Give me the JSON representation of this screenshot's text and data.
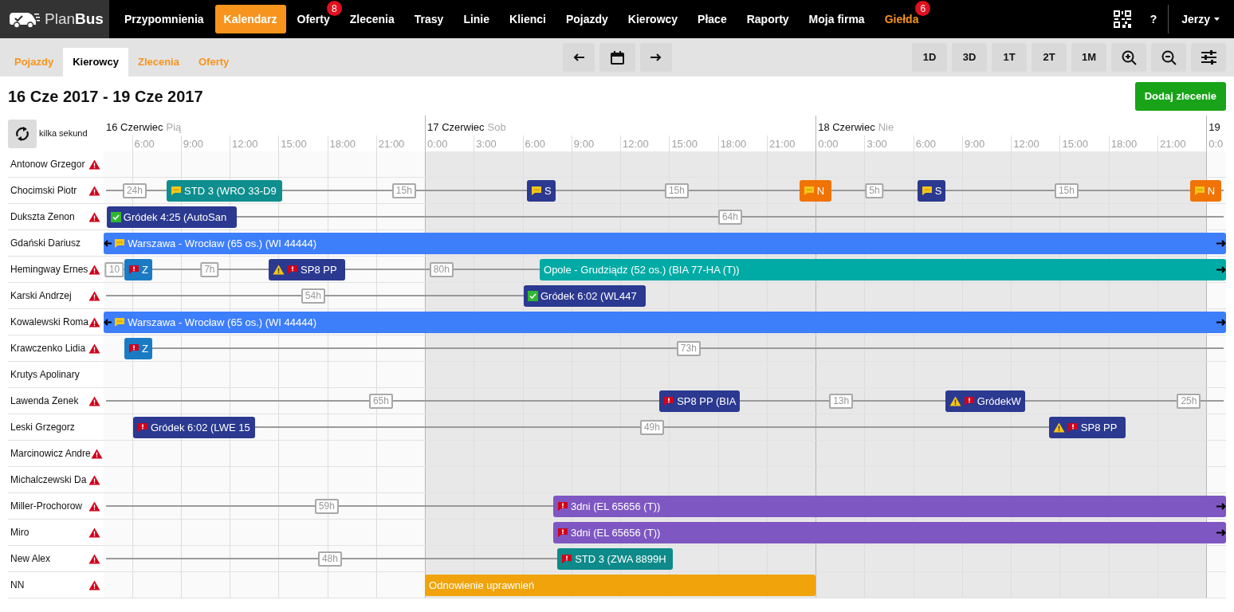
{
  "app": {
    "logo": "Plan**Bus**"
  },
  "nav": [
    {
      "label": "Przypomnienia",
      "selected": false,
      "highlighted": false
    },
    {
      "label": "Kalendarz",
      "selected": true,
      "highlighted": false
    },
    {
      "label": "Oferty",
      "selected": false,
      "highlighted": false,
      "badge": "8"
    },
    {
      "label": "Zlecenia",
      "selected": false,
      "highlighted": false
    },
    {
      "label": "Trasy",
      "selected": false,
      "highlighted": false
    },
    {
      "label": "Linie",
      "selected": false,
      "highlighted": false
    },
    {
      "label": "Klienci",
      "selected": false,
      "highlighted": false
    },
    {
      "label": "Pojazdy",
      "selected": false,
      "highlighted": false
    },
    {
      "label": "Kierowcy",
      "selected": false,
      "highlighted": false
    },
    {
      "label": "Płace",
      "selected": false,
      "highlighted": false
    },
    {
      "label": "Raporty",
      "selected": false,
      "highlighted": false
    },
    {
      "label": "Moja firma",
      "selected": false,
      "highlighted": false
    },
    {
      "label": "Giełda",
      "selected": false,
      "highlighted": true,
      "badge": "6"
    }
  ],
  "help": "?",
  "user": "Jerzy",
  "subtabs": [
    {
      "label": "Pojazdy",
      "selected": false
    },
    {
      "label": "Kierowcy",
      "selected": true
    },
    {
      "label": "Zlecenia",
      "selected": false
    },
    {
      "label": "Oferty",
      "selected": false
    }
  ],
  "range_buttons": [
    "1D",
    "3D",
    "1T",
    "2T",
    "1M"
  ],
  "title": "16 Cze 2017 - 19 Cze 2017",
  "add_button": "Dodaj zlecenie",
  "refresh": {
    "label": "kilka sekund"
  },
  "days": [
    {
      "label": "16 Czerwiec",
      "weekday": "Pią",
      "weekend": false,
      "ticks": [
        "6:00",
        "9:00",
        "12:00",
        "15:00",
        "18:00",
        "21:00"
      ]
    },
    {
      "label": "17 Czerwiec",
      "weekday": "Sob",
      "weekend": true,
      "ticks": [
        "0:00",
        "3:00",
        "6:00",
        "9:00",
        "12:00",
        "15:00",
        "18:00",
        "21:00"
      ]
    },
    {
      "label": "18 Czerwiec",
      "weekday": "Nie",
      "weekend": true,
      "ticks": [
        "0:00",
        "3:00",
        "6:00",
        "9:00",
        "12:00",
        "15:00",
        "18:00",
        "21:00"
      ]
    },
    {
      "label": "19",
      "weekend": false,
      "ticks": [
        "0:0"
      ]
    }
  ],
  "drivers": [
    {
      "name": "Antonow Grzegor",
      "warning": true
    },
    {
      "name": "Chocimski Piotr",
      "warning": true,
      "items": [
        {
          "kind": "gap",
          "label": "24h"
        },
        {
          "kind": "event",
          "label": "STD 3 (WRO 33-D9",
          "color": "#0e8e8e",
          "note": true
        },
        {
          "kind": "gap",
          "label": "15h"
        },
        {
          "kind": "event",
          "label": "S",
          "color": "#2b3990",
          "note": true
        },
        {
          "kind": "gap",
          "label": "15h"
        },
        {
          "kind": "event",
          "label": "N",
          "color": "#f07306",
          "note": true
        },
        {
          "kind": "gap",
          "label": "5h"
        },
        {
          "kind": "event",
          "label": "S",
          "color": "#2b3990",
          "note": true
        },
        {
          "kind": "gap",
          "label": "15h"
        },
        {
          "kind": "event",
          "label": "N",
          "color": "#f07306",
          "note": true
        }
      ]
    },
    {
      "name": "Dukszta Zenon",
      "warning": true,
      "items": [
        {
          "kind": "event",
          "label": "Gródek 4:25 (AutoSan",
          "color": "#2b3990",
          "confirmed": true
        },
        {
          "kind": "gap",
          "label": "64h"
        }
      ]
    },
    {
      "name": "Gdański Dariusz",
      "warning": false,
      "items": [
        {
          "kind": "event",
          "label": "Warszawa - Wrocław (65 os.) (WI 44444)",
          "color": "#3d7efb",
          "note": true,
          "continues_left": true,
          "continues_right": true
        }
      ]
    },
    {
      "name": "Hemingway Ernes",
      "warning": true,
      "items": [
        {
          "kind": "gap",
          "label": "10"
        },
        {
          "kind": "event",
          "label": "Z",
          "color": "#1a7bc4",
          "alert": true
        },
        {
          "kind": "gap",
          "label": "7h"
        },
        {
          "kind": "event",
          "label": "SP8 PP",
          "color": "#2b3990",
          "alert": true,
          "warning": true
        },
        {
          "kind": "gap",
          "label": "80h"
        },
        {
          "kind": "event",
          "label": "Opole - Grudziądz (52 os.) (BIA 77-HA (T))",
          "color": "#00aba5",
          "continues_right": true
        }
      ]
    },
    {
      "name": "Karski Andrzej",
      "warning": true,
      "items": [
        {
          "kind": "gap",
          "label": "54h"
        },
        {
          "kind": "event",
          "label": "Gródek 6:02 (WL447",
          "color": "#2b3990",
          "confirmed": true
        }
      ]
    },
    {
      "name": "Kowalewski Roma",
      "warning": true,
      "items": [
        {
          "kind": "event",
          "label": "Warszawa - Wrocław (65 os.) (WI 44444)",
          "color": "#3d7efb",
          "note": true,
          "continues_left": true,
          "continues_right": true
        }
      ]
    },
    {
      "name": "Krawczenko Lidia",
      "warning": true,
      "items": [
        {
          "kind": "event",
          "label": "Z",
          "color": "#1a7bc4",
          "alert": true
        },
        {
          "kind": "gap",
          "label": "73h"
        }
      ]
    },
    {
      "name": "Krutys Apolinary",
      "warning": false
    },
    {
      "name": "Lawenda Zenek",
      "warning": true,
      "items": [
        {
          "kind": "gap",
          "label": "65h"
        },
        {
          "kind": "event",
          "label": "SP8 PP (BIA",
          "color": "#2b3990",
          "alert": true
        },
        {
          "kind": "gap",
          "label": "13h"
        },
        {
          "kind": "event",
          "label": "GródekW",
          "color": "#2b3990",
          "alert": true,
          "warning": true
        },
        {
          "kind": "gap",
          "label": "25h"
        }
      ]
    },
    {
      "name": "Leski Grzegorz",
      "warning": false,
      "items": [
        {
          "kind": "event",
          "label": "Gródek 6:02 (LWE 15",
          "color": "#2b3990",
          "alert": true
        },
        {
          "kind": "gap",
          "label": "49h"
        },
        {
          "kind": "event",
          "label": "SP8 PP",
          "color": "#2b3990",
          "alert": true,
          "warning": true
        }
      ]
    },
    {
      "name": "Marcinowicz Andre",
      "warning": true
    },
    {
      "name": "Michalczewski Da",
      "warning": true
    },
    {
      "name": "Miller-Prochorow",
      "warning": true,
      "items": [
        {
          "kind": "gap",
          "label": "59h"
        },
        {
          "kind": "event",
          "label": "3dni (EL 65656 (T))",
          "color": "#7e57c2",
          "alert": true,
          "continues_right": true
        }
      ]
    },
    {
      "name": "Miro",
      "warning": true,
      "items": [
        {
          "kind": "event",
          "label": "3dni (EL 65656 (T))",
          "color": "#7e57c2",
          "alert": true,
          "continues_right": true
        }
      ]
    },
    {
      "name": "New Alex",
      "warning": true,
      "items": [
        {
          "kind": "gap",
          "label": "48h"
        },
        {
          "kind": "event",
          "label": "STD 3 (ZWA 8899H",
          "color": "#0e8a8a",
          "alert": true
        }
      ]
    },
    {
      "name": "NN",
      "warning": true,
      "items": [
        {
          "kind": "event",
          "label": "Odnowienie uprawnień",
          "color": "#f0a30a"
        }
      ]
    }
  ]
}
